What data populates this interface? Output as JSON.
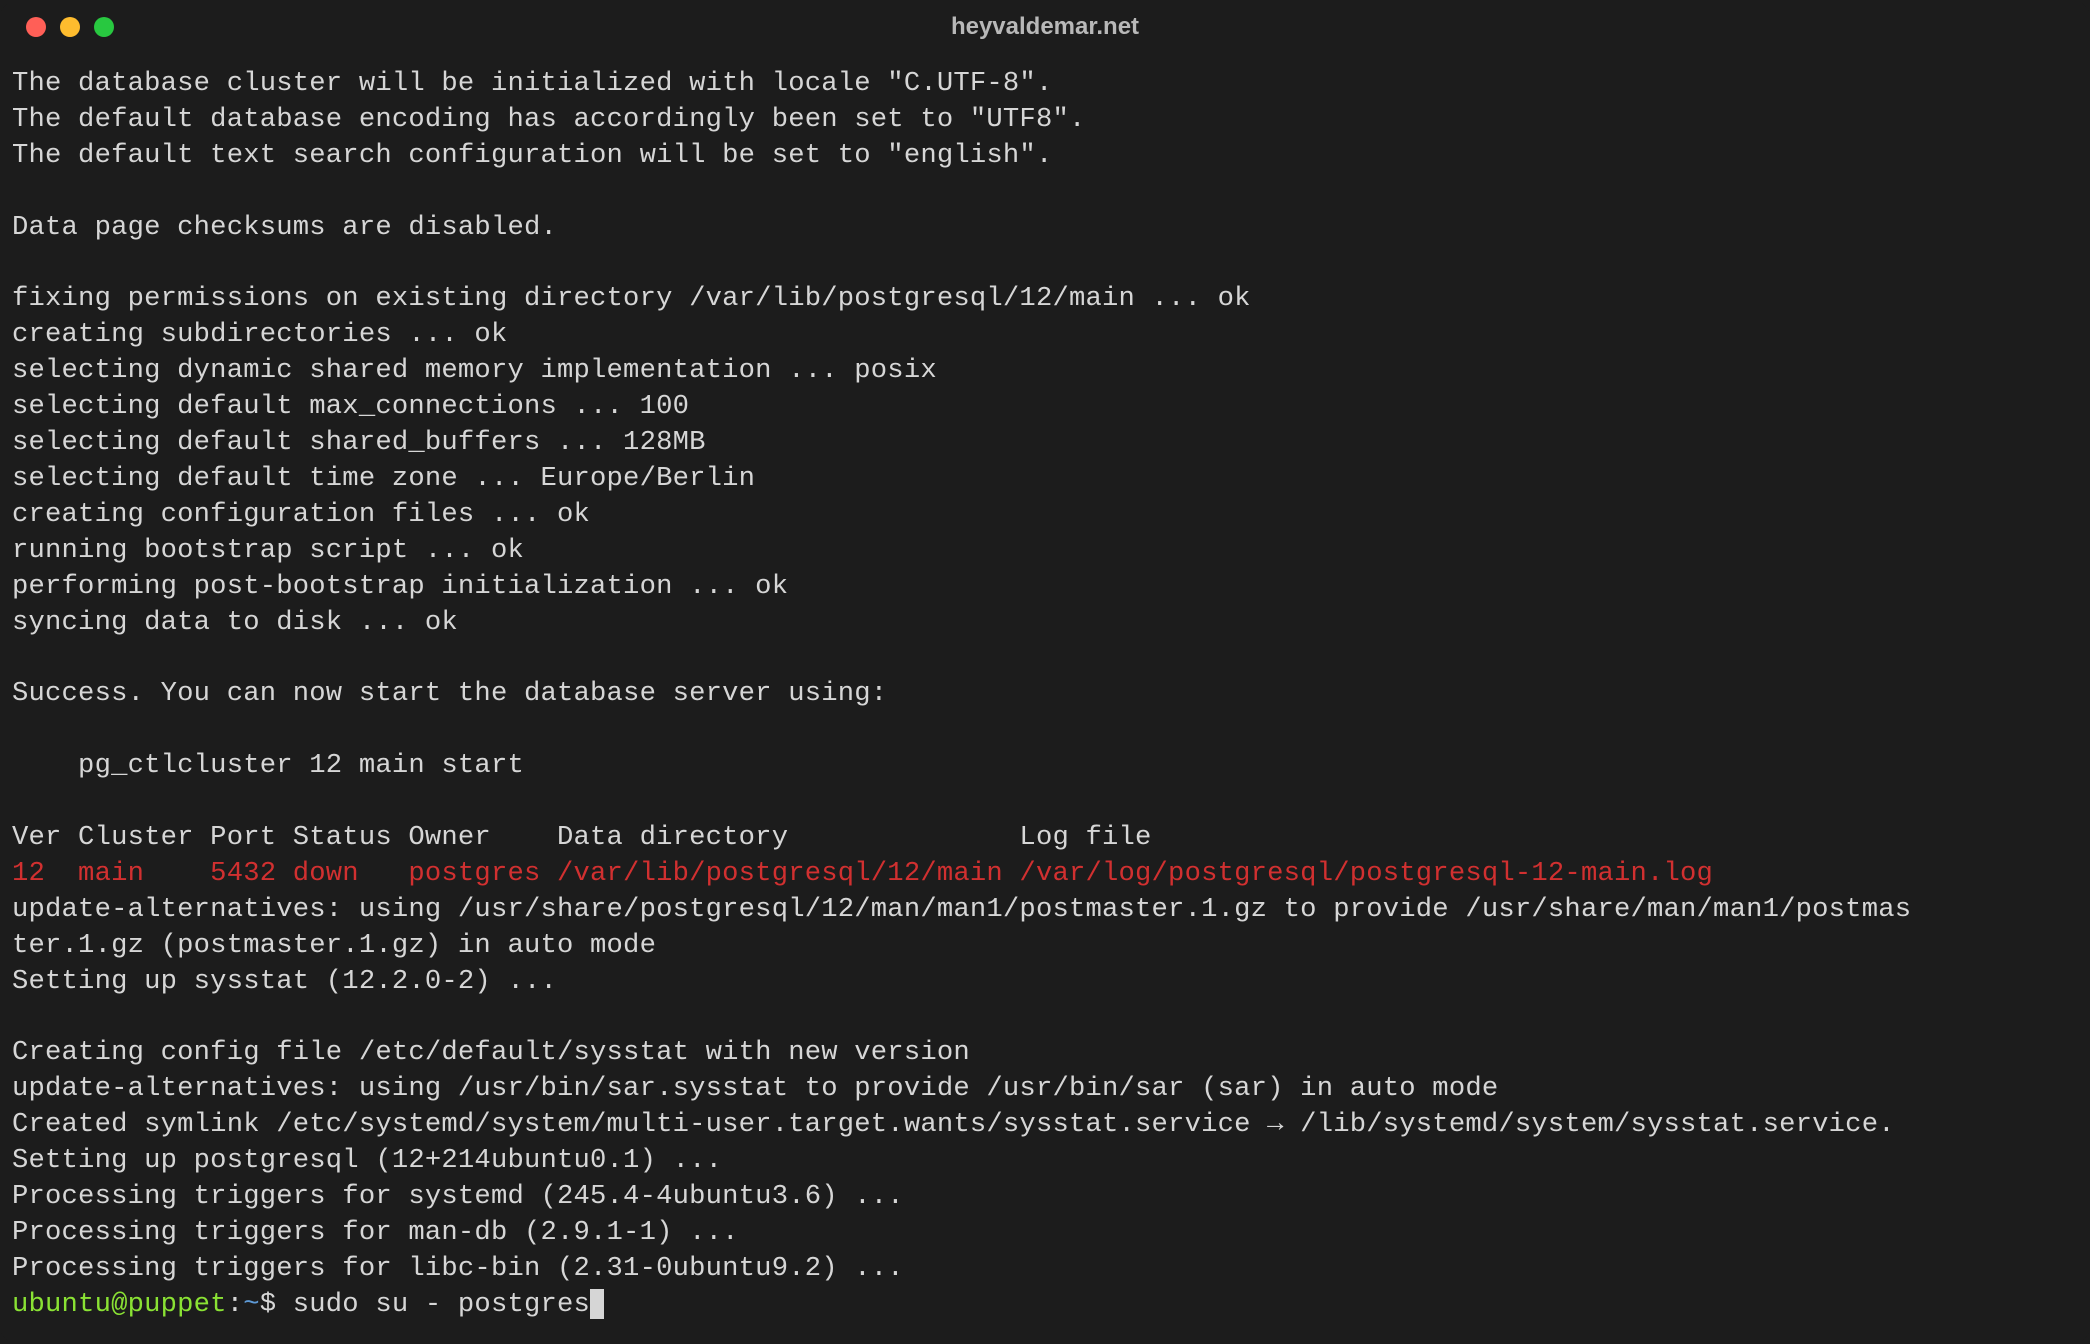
{
  "titlebar": {
    "title": "heyvaldemar.net"
  },
  "output": {
    "lines": [
      "The database cluster will be initialized with locale \"C.UTF-8\".",
      "The default database encoding has accordingly been set to \"UTF8\".",
      "The default text search configuration will be set to \"english\".",
      "",
      "Data page checksums are disabled.",
      "",
      "fixing permissions on existing directory /var/lib/postgresql/12/main ... ok",
      "creating subdirectories ... ok",
      "selecting dynamic shared memory implementation ... posix",
      "selecting default max_connections ... 100",
      "selecting default shared_buffers ... 128MB",
      "selecting default time zone ... Europe/Berlin",
      "creating configuration files ... ok",
      "running bootstrap script ... ok",
      "performing post-bootstrap initialization ... ok",
      "syncing data to disk ... ok",
      "",
      "Success. You can now start the database server using:",
      "",
      "    pg_ctlcluster 12 main start",
      "",
      "Ver Cluster Port Status Owner    Data directory              Log file"
    ],
    "red_line": "12  main    5432 down   postgres /var/lib/postgresql/12/main /var/log/postgresql/postgresql-12-main.log",
    "lines2": [
      "update-alternatives: using /usr/share/postgresql/12/man/man1/postmaster.1.gz to provide /usr/share/man/man1/postmas",
      "ter.1.gz (postmaster.1.gz) in auto mode",
      "Setting up sysstat (12.2.0-2) ...",
      "",
      "Creating config file /etc/default/sysstat with new version",
      "update-alternatives: using /usr/bin/sar.sysstat to provide /usr/bin/sar (sar) in auto mode",
      "Created symlink /etc/systemd/system/multi-user.target.wants/sysstat.service → /lib/systemd/system/sysstat.service.",
      "Setting up postgresql (12+214ubuntu0.1) ...",
      "Processing triggers for systemd (245.4-4ubuntu3.6) ...",
      "Processing triggers for man-db (2.9.1-1) ...",
      "Processing triggers for libc-bin (2.31-0ubuntu9.2) ..."
    ]
  },
  "prompt": {
    "user_host": "ubuntu@puppet",
    "colon": ":",
    "path": "~",
    "dollar": "$ ",
    "command": "sudo su - postgres"
  }
}
